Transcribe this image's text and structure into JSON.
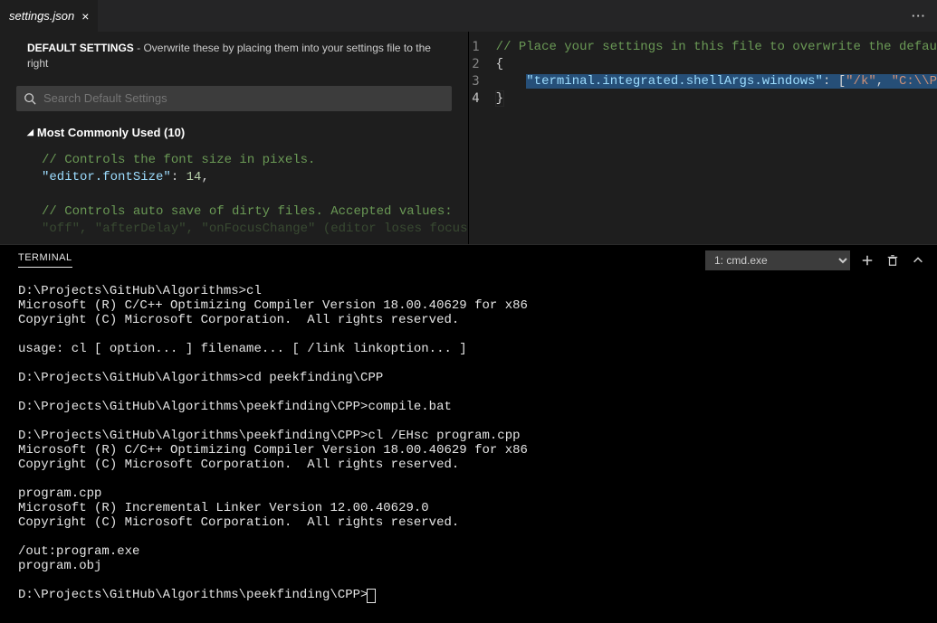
{
  "tab": {
    "title": "settings.json"
  },
  "left": {
    "hint_bold": "DEFAULT SETTINGS",
    "hint_rest": " - Overwrite these by placing them into your settings file to the right",
    "search_placeholder": "Search Default Settings",
    "section_title": "Most Commonly Used (10)",
    "code": {
      "c1": "// Controls the font size in pixels.",
      "k1": "\"editor.fontSize\"",
      "v1": "14",
      "c2": "// Controls auto save of dirty files. Accepted values:",
      "c3": "\"off\", \"afterDelay\", \"onFocusChange\" (editor loses focus)"
    }
  },
  "right": {
    "lines": {
      "n1": "1",
      "n2": "2",
      "n3": "3",
      "n4": "4"
    },
    "l1": "// Place your settings in this file to overwrite the defau",
    "l2": "{",
    "l3_key": "\"terminal.integrated.shellArgs.windows\"",
    "l3_mid": ": [",
    "l3_v1": "\"/k\"",
    "l3_comma": ", ",
    "l3_v2": "\"C:\\\\P",
    "l4": "}"
  },
  "panel": {
    "title": "TERMINAL",
    "select_label": "1: cmd.exe",
    "select_value": "cmd.exe"
  },
  "terminal_lines": [
    "D:\\Projects\\GitHub\\Algorithms>cl",
    "Microsoft (R) C/C++ Optimizing Compiler Version 18.00.40629 for x86",
    "Copyright (C) Microsoft Corporation.  All rights reserved.",
    "",
    "usage: cl [ option... ] filename... [ /link linkoption... ]",
    "",
    "D:\\Projects\\GitHub\\Algorithms>cd peekfinding\\CPP",
    "",
    "D:\\Projects\\GitHub\\Algorithms\\peekfinding\\CPP>compile.bat",
    "",
    "D:\\Projects\\GitHub\\Algorithms\\peekfinding\\CPP>cl /EHsc program.cpp",
    "Microsoft (R) C/C++ Optimizing Compiler Version 18.00.40629 for x86",
    "Copyright (C) Microsoft Corporation.  All rights reserved.",
    "",
    "program.cpp",
    "Microsoft (R) Incremental Linker Version 12.00.40629.0",
    "Copyright (C) Microsoft Corporation.  All rights reserved.",
    "",
    "/out:program.exe",
    "program.obj",
    "",
    "D:\\Projects\\GitHub\\Algorithms\\peekfinding\\CPP>"
  ]
}
